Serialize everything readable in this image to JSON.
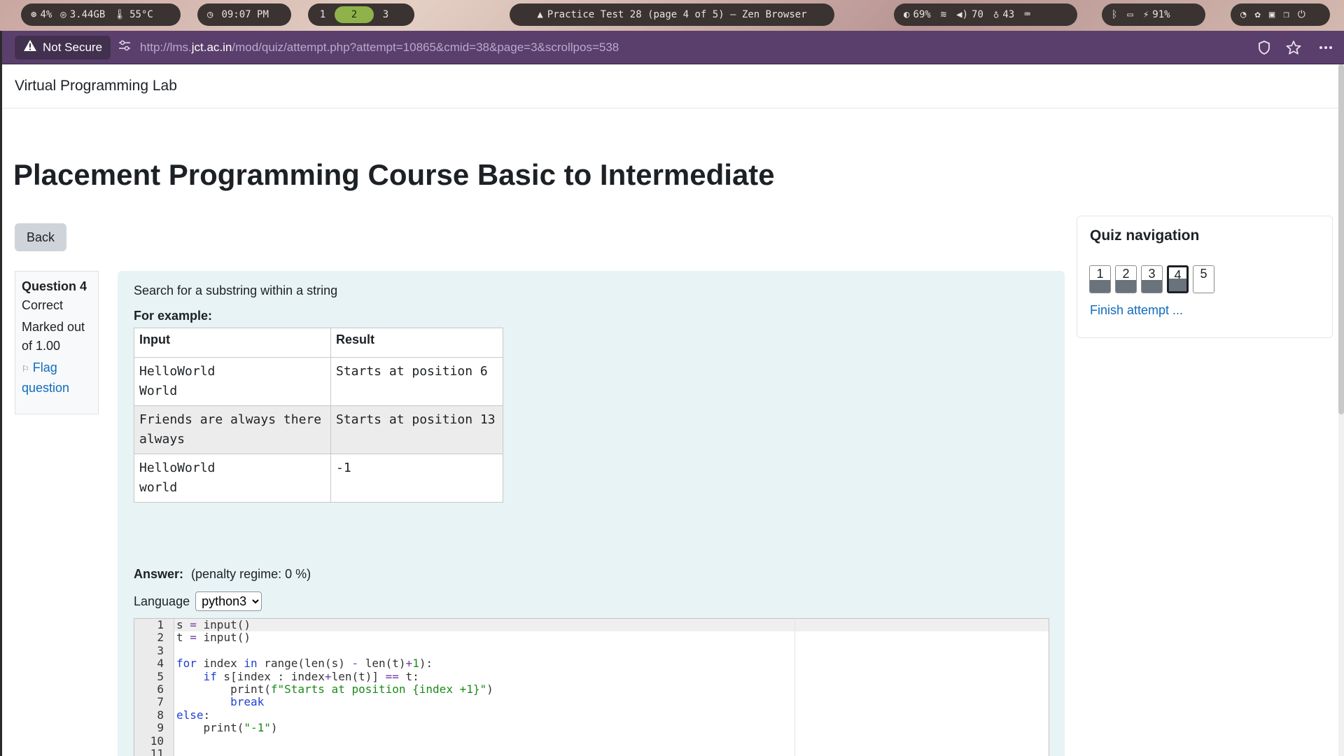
{
  "system_bar": {
    "cpu": "4%",
    "memory": "3.44GB",
    "temp": "55°C",
    "time": "09:07 PM",
    "workspaces": [
      "1",
      "2",
      "3"
    ],
    "active_workspace": "2",
    "window_title": "Practice Test 28 (page 4 of 5) — Zen Browser",
    "brightness": "69%",
    "volume": "70",
    "mic": "43",
    "battery": "91%"
  },
  "browser": {
    "security_label": "Not Secure",
    "url_prefix": "http://lms.",
    "url_domain": "jct.ac.in",
    "url_path": "/mod/quiz/attempt.php?attempt=10865&cmid=38&page=3&scrollpos=538"
  },
  "page": {
    "site_name": "Virtual Programming Lab",
    "course_title": "Placement Programming Course Basic to Intermediate",
    "back_label": "Back"
  },
  "question_info": {
    "number_label": "Question 4",
    "state": "Correct",
    "marks": "Marked out of 1.00",
    "flag_label": "Flag question"
  },
  "question": {
    "text": "Search for a substring within a string",
    "example_heading": "For example:",
    "table": {
      "headers": [
        "Input",
        "Result"
      ],
      "rows": [
        {
          "input": [
            "HelloWorld",
            "World"
          ],
          "result": "Starts at position 6"
        },
        {
          "input": [
            "Friends are always there",
            "always"
          ],
          "result": "Starts at position 13"
        },
        {
          "input": [
            "HelloWorld",
            "world"
          ],
          "result": "-1"
        }
      ]
    },
    "answer_label": "Answer:",
    "penalty": "(penalty regime: 0 %)",
    "language_label": "Language",
    "language_value": "python3",
    "code_lines": [
      "s = input()",
      "t = input()",
      "",
      "for index in range(len(s) - len(t)+1):",
      "    if s[index : index+len(t)] == t:",
      "        print(f\"Starts at position {index +1}\")",
      "        break",
      "else:",
      "    print(\"-1\")",
      "",
      "",
      ""
    ]
  },
  "quiz_nav": {
    "title": "Quiz navigation",
    "questions": [
      {
        "label": "1",
        "answered": true,
        "current": false
      },
      {
        "label": "2",
        "answered": true,
        "current": false
      },
      {
        "label": "3",
        "answered": true,
        "current": false
      },
      {
        "label": "4",
        "answered": true,
        "current": true
      },
      {
        "label": "5",
        "answered": false,
        "current": false
      }
    ],
    "finish_label": "Finish attempt ..."
  },
  "colors": {
    "link": "#0f6cbf",
    "urlbar": "#5a3f6c",
    "question_bg": "#e7f3f5",
    "answered_fill": "#6a737b"
  }
}
